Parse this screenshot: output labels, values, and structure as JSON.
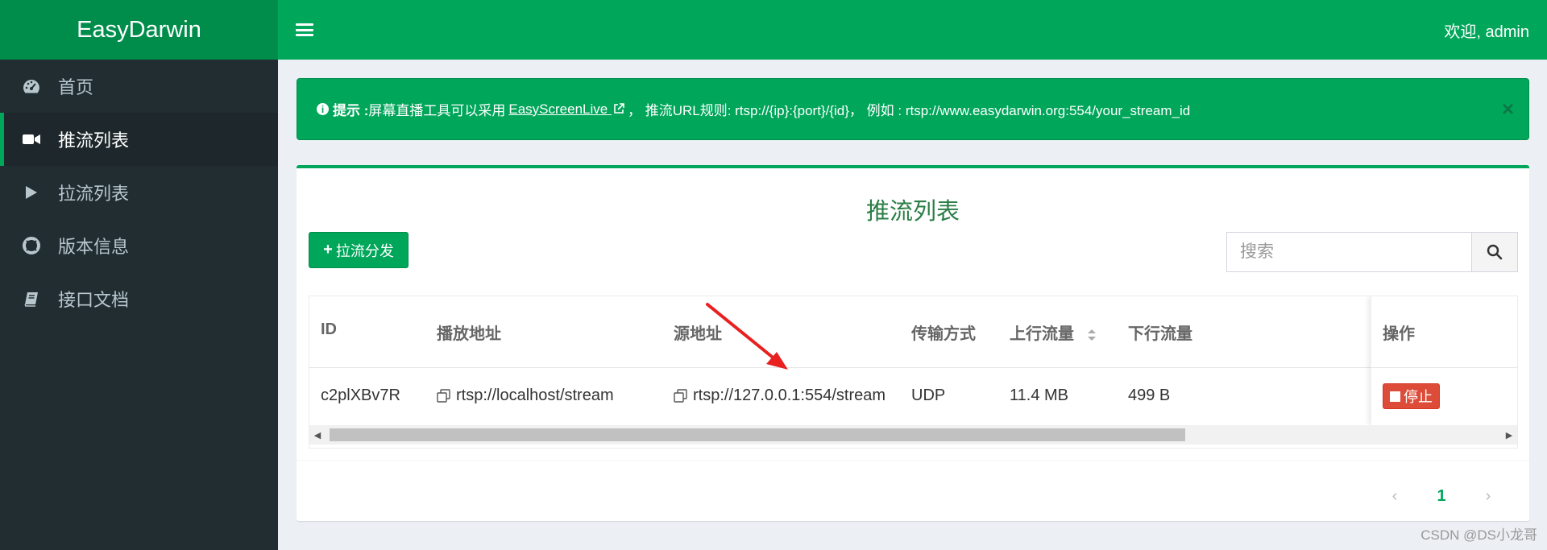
{
  "app": {
    "brand": "EasyDarwin",
    "welcome": "欢迎, admin"
  },
  "sidebar": {
    "items": [
      {
        "label": "首页",
        "icon": "dashboard-icon",
        "active": false
      },
      {
        "label": "推流列表",
        "icon": "video-camera-icon",
        "active": true
      },
      {
        "label": "拉流列表",
        "icon": "play-icon",
        "active": false
      },
      {
        "label": "版本信息",
        "icon": "life-ring-icon",
        "active": false
      },
      {
        "label": "接口文档",
        "icon": "book-icon",
        "active": false
      }
    ]
  },
  "alert": {
    "prefix": "提示 :",
    "text1": "屏幕直播工具可以采用",
    "link": "EasyScreenLive",
    "text2": "，  推流URL规则: rtsp://{ip}:{port}/{id}，  例如 : rtsp://www.easydarwin.org:554/your_stream_id",
    "close": "×"
  },
  "main": {
    "title": "推流列表",
    "add_button": "拉流分发",
    "search_placeholder": "搜索"
  },
  "table": {
    "headers": [
      "ID",
      "播放地址",
      "源地址",
      "传输方式",
      "上行流量",
      "下行流量",
      "操作"
    ],
    "rows": [
      {
        "id": "c2plXBv7R",
        "play_url": "rtsp://localhost/stream",
        "source_url": "rtsp://127.0.0.1:554/stream",
        "transport": "UDP",
        "up": "11.4 MB",
        "down": "499 B",
        "action": "停止"
      }
    ]
  },
  "pagination": {
    "prev": "‹",
    "current": "1",
    "next": "›"
  },
  "watermark": "CSDN @DS小龙哥",
  "colors": {
    "primary": "#00a65a",
    "primary_dark": "#008d4c",
    "sidebar": "#222d32",
    "danger": "#dd4b39",
    "arrow": "#e82020"
  }
}
